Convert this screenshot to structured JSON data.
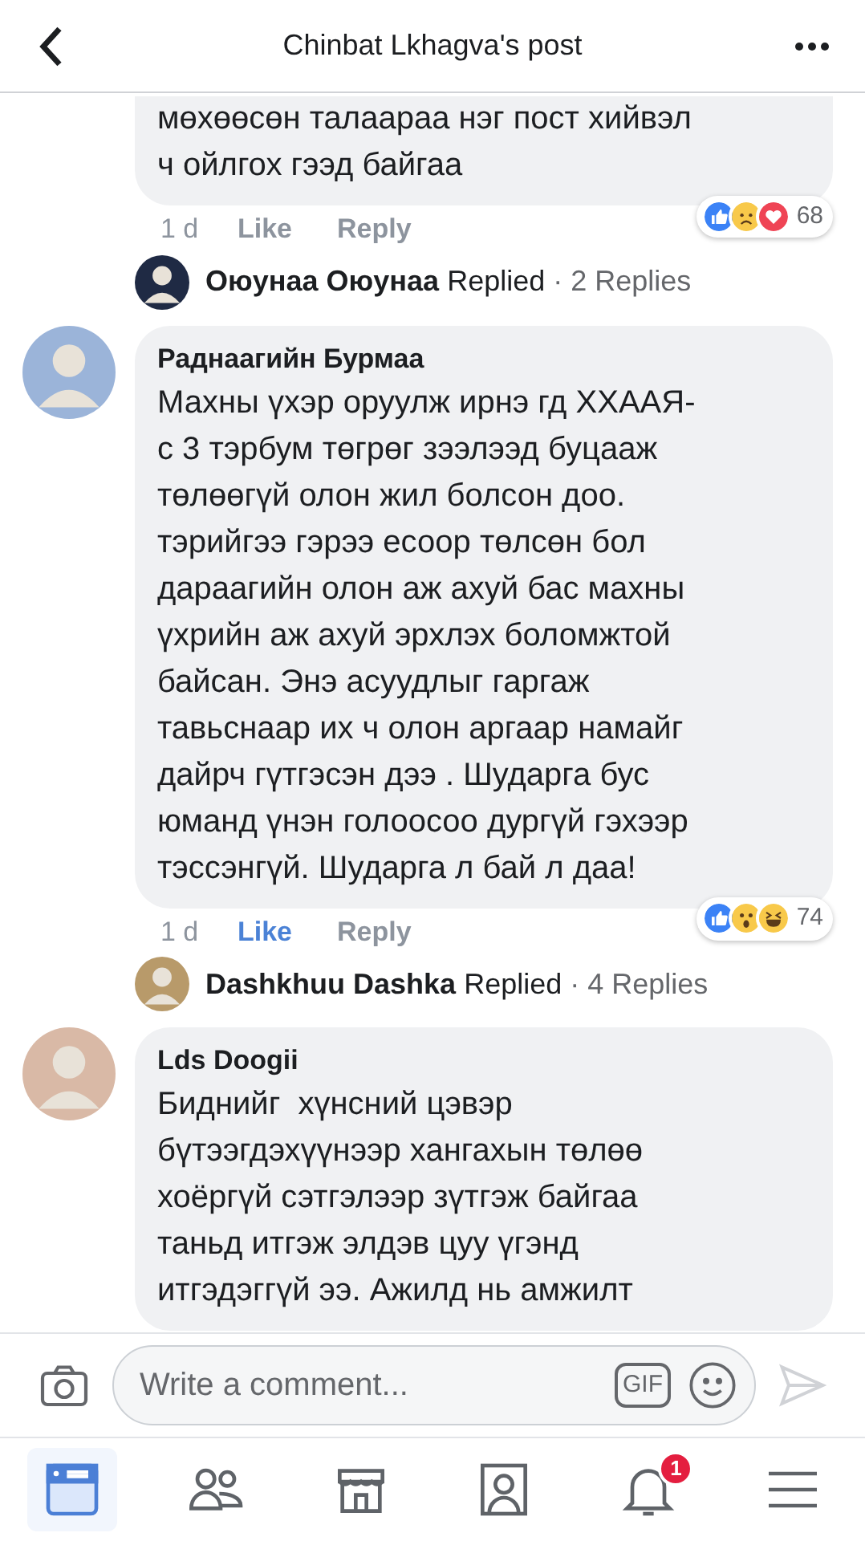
{
  "header": {
    "title": "Chinbat Lkhagva's post"
  },
  "comments": [
    {
      "text": "мөхөөсөн талаараа нэг пост хийвэл\nч ойлгох гээд байгаа",
      "time": "1 d",
      "like": "Like",
      "liked": false,
      "reply": "Reply",
      "reactions": [
        {
          "kind": "like"
        },
        {
          "kind": "sad"
        },
        {
          "kind": "love"
        }
      ],
      "reaction_count": "68",
      "replied": {
        "name": "Оюунаа Оюунаа",
        "verb": "Replied",
        "count": "· 2 Replies"
      }
    },
    {
      "author": "Раднаагийн Бурмаа",
      "text": "Махны үхэр оруулж ирнэ гд ХХААЯ-\nс 3 тэрбум төгрөг зээлээд буцааж\nтөлөөгүй олон жил болсон доо.\nтэрийгээ гэрээ есоор төлсөн бол\nдараагийн олон аж ахуй бас махны\nүхрийн аж ахуй эрхлэх боломжтой\nбайсан. Энэ асуудлыг гаргаж\nтавьснаар их ч олон аргаар намайг\nдайрч гүтгэсэн дээ . Шударга бус\nюманд үнэн голоосоо дургүй гэхээр\nтэссэнгүй. Шударга л бай л даа!",
      "time": "1 d",
      "like": "Like",
      "liked": true,
      "reply": "Reply",
      "reactions": [
        {
          "kind": "like"
        },
        {
          "kind": "wow"
        },
        {
          "kind": "haha"
        }
      ],
      "reaction_count": "74",
      "replied": {
        "name": "Dashkhuu Dashka",
        "verb": "Replied",
        "count": "· 4 Replies"
      }
    },
    {
      "author": "Lds Doogii",
      "text": "Биднийг  хүнсний цэвэр\nбүтээгдэхүүнээр хангахын төлөө\nхоёргүй сэтгэлээр зүтгэж байгаа\nтаньд итгэж элдэв цуу үгэнд\nитгэдэггүй ээ. Ажилд нь амжилт"
    }
  ],
  "composer": {
    "placeholder": "Write a comment...",
    "gif": "GIF"
  },
  "nav": [
    {
      "kind": "feed",
      "selected": true
    },
    {
      "kind": "friends",
      "selected": false
    },
    {
      "kind": "market",
      "selected": false
    },
    {
      "kind": "profile",
      "selected": false
    },
    {
      "kind": "bell",
      "selected": false,
      "badge": "1"
    },
    {
      "kind": "menu",
      "selected": false
    }
  ]
}
